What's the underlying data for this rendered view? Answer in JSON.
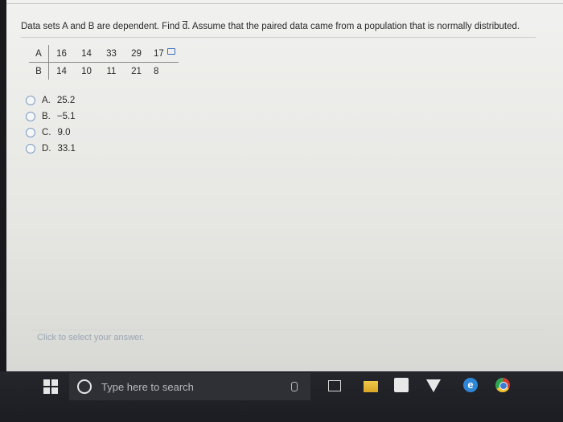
{
  "question": {
    "prefix": "Data sets A and B are dependent. Find ",
    "symbol": "d",
    "suffix": ". Assume that the paired data came from a population that is normally distributed."
  },
  "table": {
    "row_a": {
      "label": "A",
      "values": [
        "16",
        "14",
        "33",
        "29",
        "17"
      ]
    },
    "row_b": {
      "label": "B",
      "values": [
        "14",
        "10",
        "11",
        "21",
        "8"
      ]
    },
    "copy_icon": "copy-icon"
  },
  "choices": [
    {
      "letter": "A.",
      "value": "25.2"
    },
    {
      "letter": "B.",
      "value": "−5.1"
    },
    {
      "letter": "C.",
      "value": "9.0"
    },
    {
      "letter": "D.",
      "value": "33.1"
    }
  ],
  "footer_hint": "Click to select your answer.",
  "taskbar": {
    "search_placeholder": "Type here to search",
    "icons": [
      "windows-start-icon",
      "cortana-icon",
      "microphone-icon",
      "task-view-icon",
      "file-explorer-icon",
      "store-icon",
      "vpn-icon",
      "edge-icon",
      "chrome-icon"
    ]
  },
  "colors": {
    "radio_border": "#7a9cc8",
    "hint_text": "#9aa6b4",
    "taskbar_bg": "#1c1d22"
  }
}
